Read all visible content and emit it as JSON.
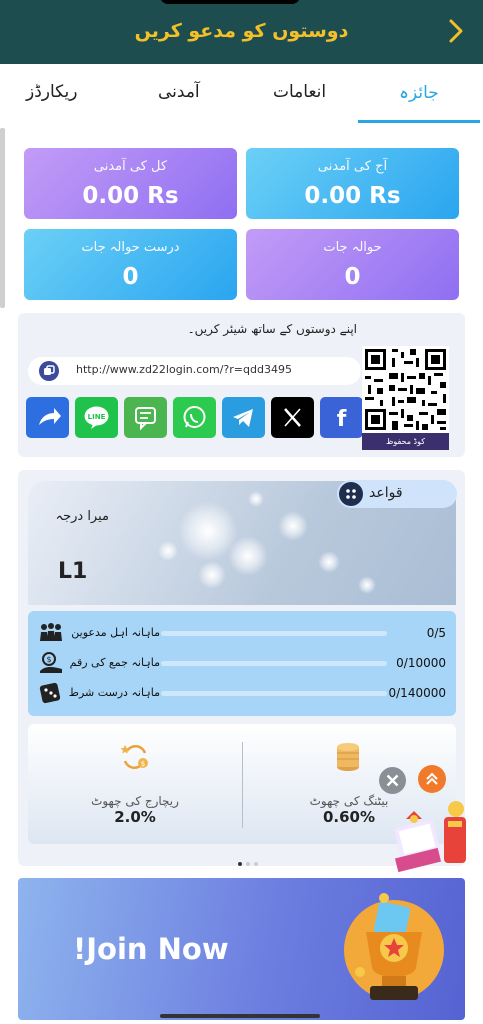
{
  "header": {
    "title": "دوستوں کو مدعو کریں",
    "back_icon": "chevron-left-icon",
    "background": "#1d4d4f",
    "title_color": "#f3c02a"
  },
  "tabs": [
    {
      "label": "جائزہ",
      "active": true
    },
    {
      "label": "انعامات",
      "active": false
    },
    {
      "label": "آمدنی",
      "active": false
    },
    {
      "label": "ریکارڈز",
      "active": false
    }
  ],
  "stats": {
    "total_income": {
      "label": "کل کی آمدنی",
      "value": "0.00 Rs"
    },
    "today_income": {
      "label": "آج کی آمدنی",
      "value": "0.00 Rs"
    },
    "valid_referrals": {
      "label": "درست حوالہ جات",
      "value": "0"
    },
    "referrals": {
      "label": "حوالہ جات",
      "value": "0"
    }
  },
  "share": {
    "title": "اپنے دوستوں کے ساتھ شیئر کریں۔",
    "link": "http://www.zd22login.com/?r=qdd3495",
    "qr_caption": "کوڈ محفوظ",
    "social_icons": [
      "share-icon",
      "line-icon",
      "sms-icon",
      "whatsapp-icon",
      "telegram-icon",
      "x-icon",
      "facebook-icon"
    ]
  },
  "rules": {
    "label": "قواعد"
  },
  "level": {
    "label": "میرا درجہ",
    "value": "L1"
  },
  "progress": [
    {
      "label": "ماہانہ اہل مدعوین",
      "value": "0/5",
      "fraction": 0
    },
    {
      "label": "ماہانہ جمع کی رقم",
      "value": "0/10000",
      "fraction": 0
    },
    {
      "label": "ماہانہ درست شرط",
      "value": "0/140000",
      "fraction": 0
    }
  ],
  "rebates": {
    "recharge": {
      "label": "ریچارج کی چھوٹ",
      "value": "2.0%"
    },
    "betting": {
      "label": "بیٹنگ کی چھوٹ",
      "value": "0.60%"
    }
  },
  "banner": {
    "text": "!Join Now"
  },
  "colors": {
    "accent": "#2aa7e0",
    "purple": "#8f6ff2",
    "blue": "#2aa5f0"
  }
}
